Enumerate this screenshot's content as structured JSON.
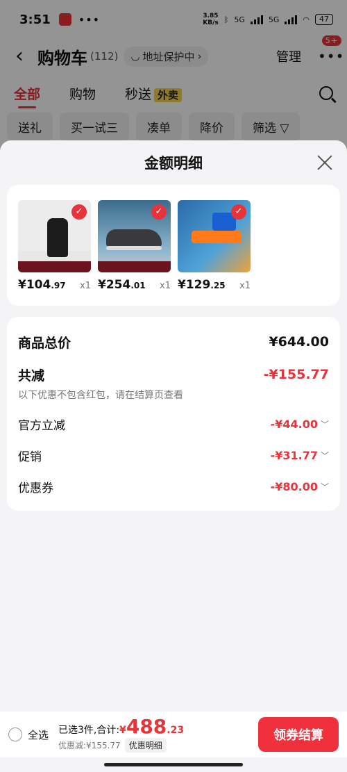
{
  "status_bar": {
    "time": "3:51",
    "dots": "•••",
    "speed_top": "3.85",
    "speed_bottom": "KB/s",
    "net1": "5G",
    "net2": "5G",
    "battery": "47"
  },
  "header": {
    "back": "‹",
    "title": "购物车",
    "count": "(112)",
    "address_label": "地址保护中",
    "address_chevron": "›",
    "manage": "管理",
    "more": "•••",
    "badge": "5+"
  },
  "tabs": [
    {
      "label": "全部"
    },
    {
      "label": "购物"
    },
    {
      "label": "秒送",
      "tag": "外卖"
    }
  ],
  "chips": [
    "送礼",
    "买一试三",
    "凑单",
    "降价",
    "筛选 ▽"
  ],
  "sheet": {
    "title": "金额明细",
    "products": [
      {
        "price_int": "¥104",
        "price_dec": ".97",
        "qty": "x1",
        "check": "✓"
      },
      {
        "price_int": "¥254",
        "price_dec": ".01",
        "qty": "x1",
        "check": "✓"
      },
      {
        "price_int": "¥129",
        "price_dec": ".25",
        "qty": "x1",
        "check": "✓"
      }
    ],
    "details": {
      "total_label": "商品总价",
      "total_value": "¥644.00",
      "reduce_label": "共减",
      "reduce_value": "-¥155.77",
      "note": "以下优惠不包含红包，请在结算页查看",
      "items": [
        {
          "label": "官方立减",
          "value": "-¥44.00"
        },
        {
          "label": "促销",
          "value": "-¥31.77"
        },
        {
          "label": "优惠券",
          "value": "-¥80.00"
        }
      ],
      "chevron": "﹀"
    }
  },
  "bottom": {
    "select_all": "全选",
    "selected_text": "已选3件,合计:",
    "currency": "¥",
    "total_int": "488",
    "total_dec": ".23",
    "discount_text": "优惠减:¥155.77",
    "detail_tag": "优惠明细",
    "checkout": "领券结算"
  },
  "colors": {
    "accent": "#e8333a",
    "checkout_button": "#f0303d",
    "waimai_tag": "#f5d34a"
  }
}
